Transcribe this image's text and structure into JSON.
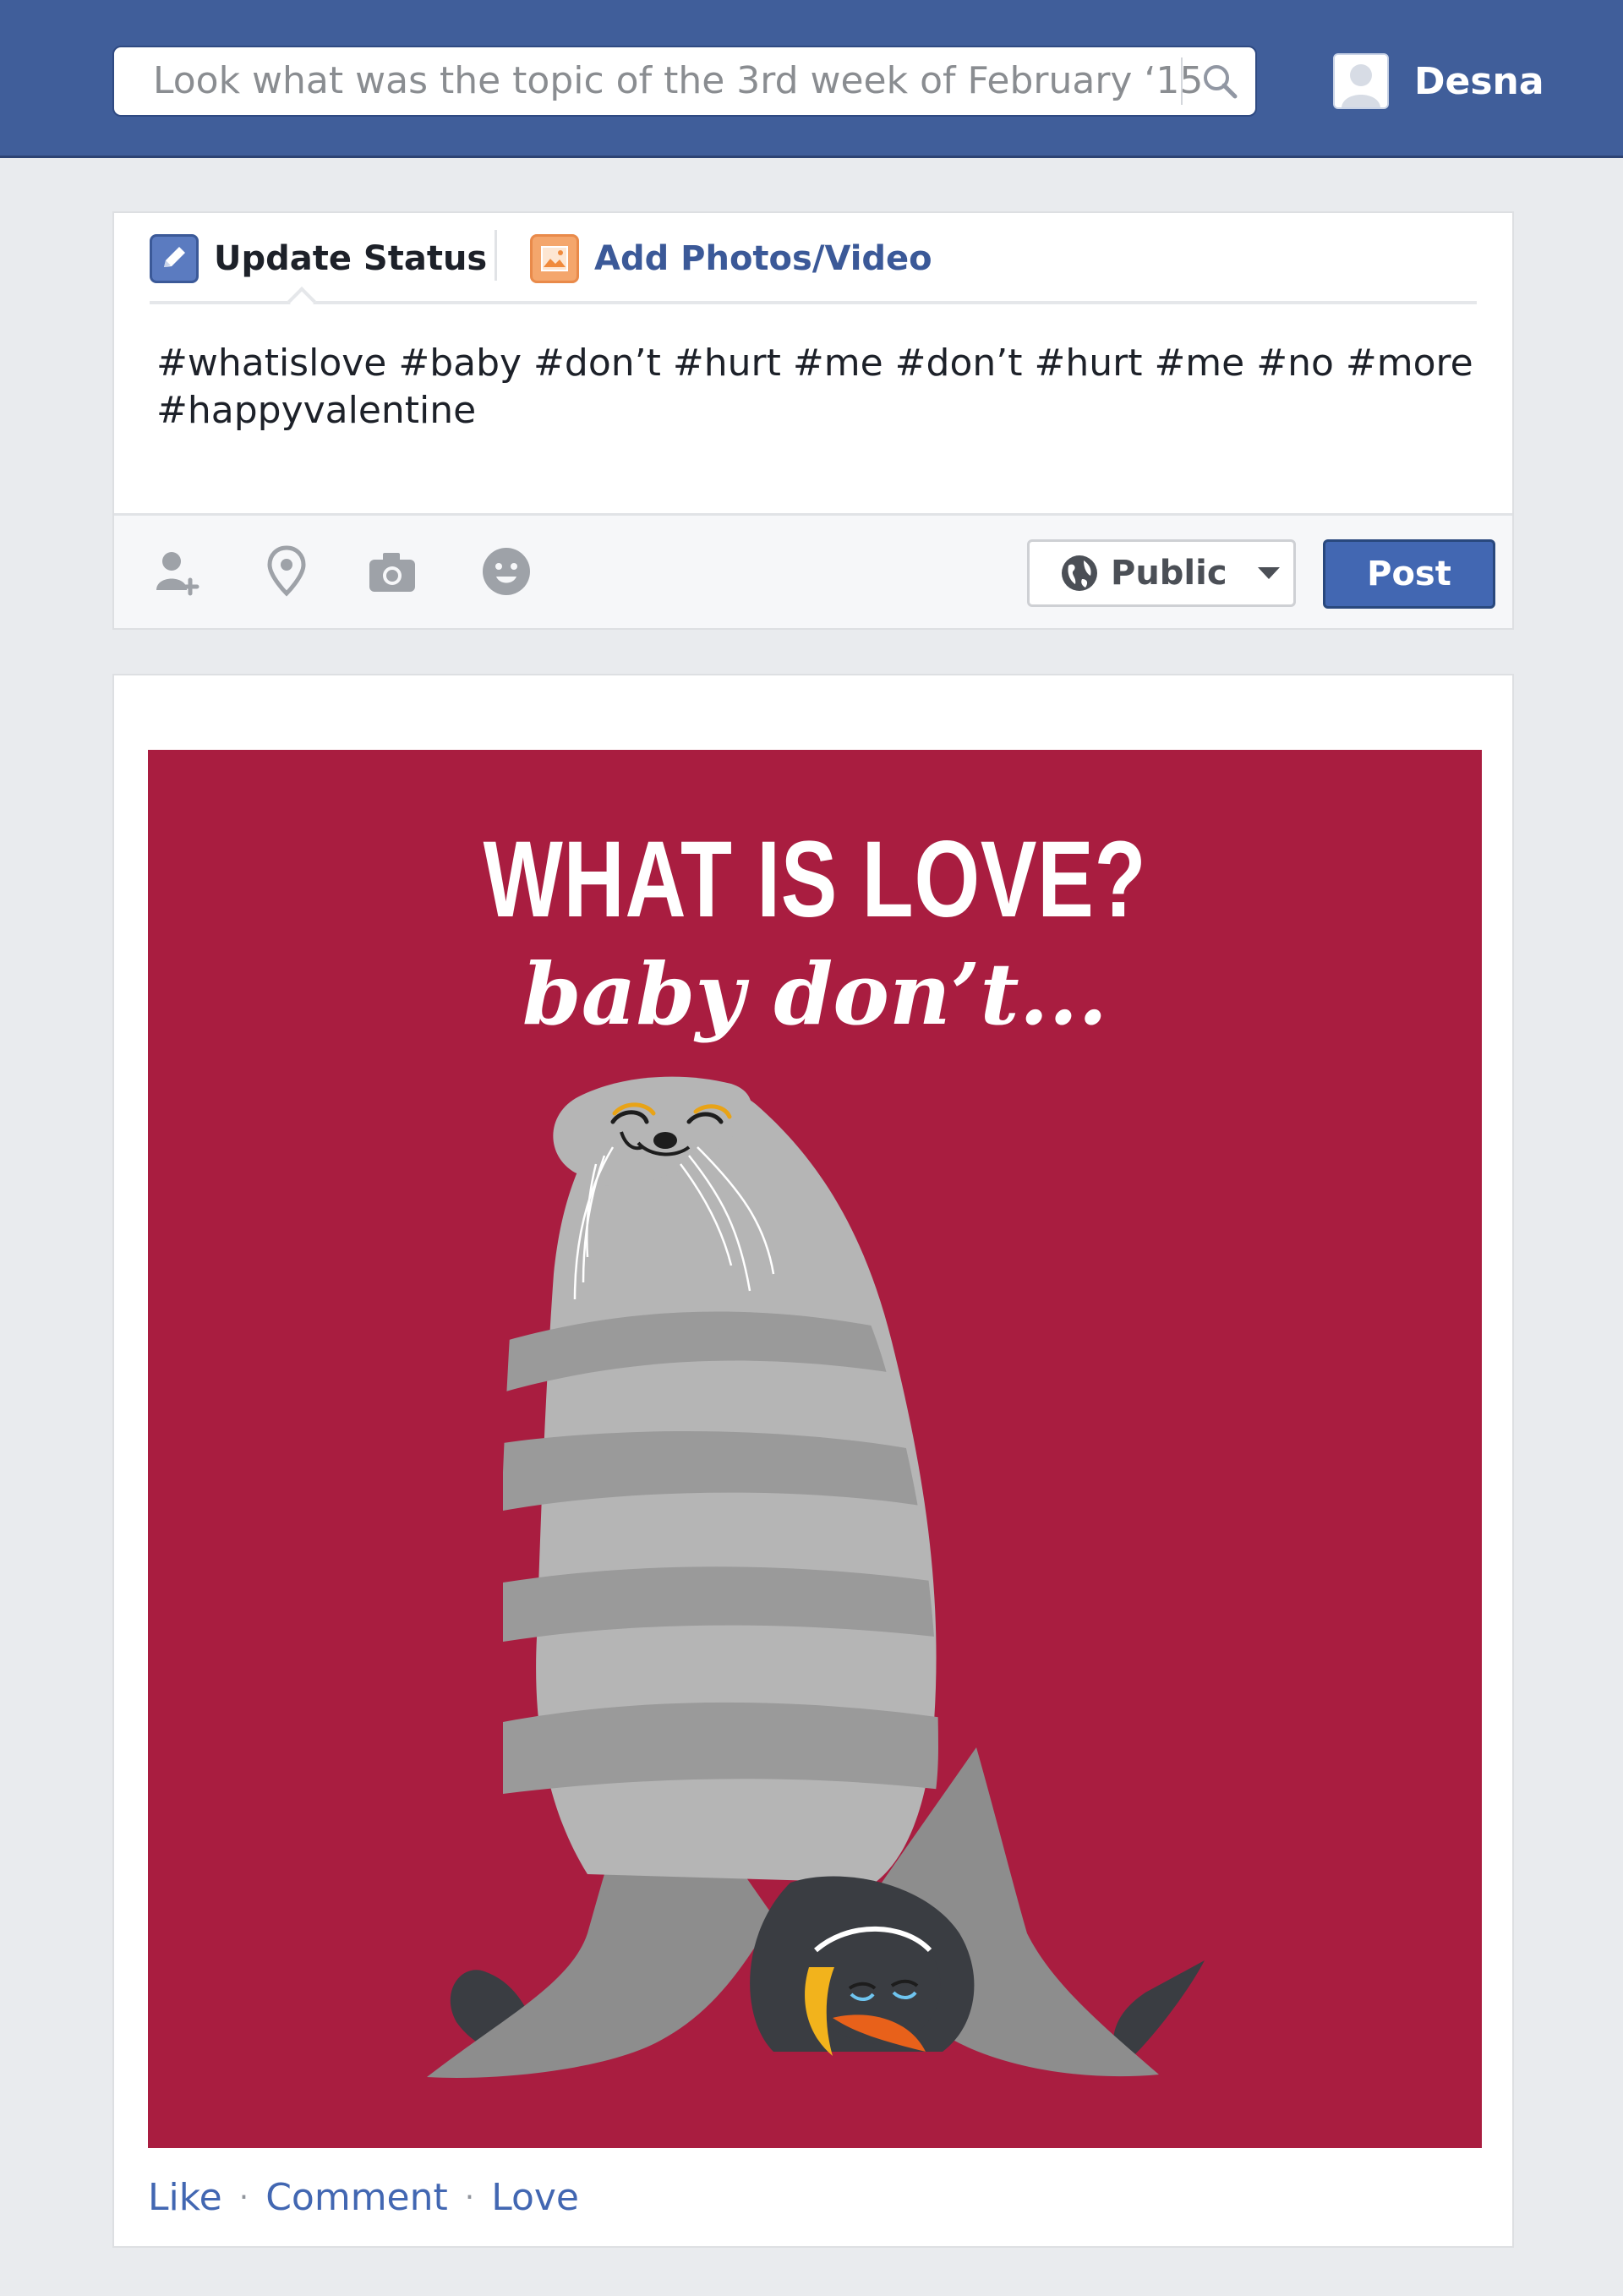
{
  "search": {
    "value": "Look what was the topic of the 3rd week of February ‘15",
    "icon": "search-icon"
  },
  "profile": {
    "name": "Desna",
    "avatar_icon": "user-silhouette-icon"
  },
  "composer": {
    "tabs": [
      {
        "label": "Update Status",
        "icon": "pencil-icon",
        "active": true
      },
      {
        "label": "Add Photos/Video",
        "icon": "photo-icon",
        "active": false
      }
    ],
    "status_text": "#whatislove #baby #don’t #hurt #me #don’t #hurt #me #no #more #happyvalentine",
    "footer_icons": [
      "tag-friends-icon",
      "location-pin-icon",
      "camera-icon",
      "emoji-icon"
    ],
    "privacy": {
      "label": "Public",
      "icon": "globe-icon"
    },
    "post_label": "Post"
  },
  "post": {
    "image": {
      "title": "WHAT IS LOVE?",
      "subtitle": "baby don’t...",
      "background": "#a91d40"
    },
    "actions": [
      "Like",
      "Comment",
      "Love"
    ],
    "separator": "·"
  },
  "colors": {
    "brand": "#405e9a",
    "link": "#4267b2",
    "page_bg": "#e9ebee"
  }
}
